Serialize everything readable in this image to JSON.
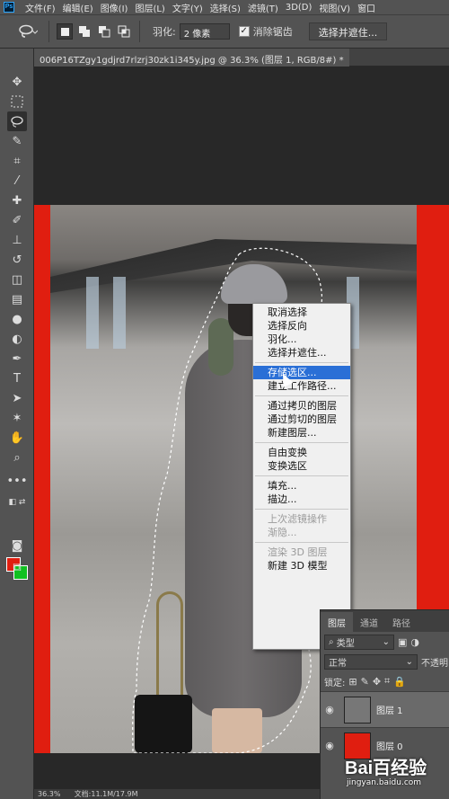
{
  "menubar": {
    "logo": "Ps",
    "items": [
      "文件(F)",
      "编辑(E)",
      "图像(I)",
      "图层(L)",
      "文字(Y)",
      "选择(S)",
      "滤镜(T)",
      "3D(D)",
      "视图(V)",
      "窗口"
    ]
  },
  "options": {
    "feather_label": "羽化:",
    "feather_value": "2 像素",
    "antialias_label": "消除锯齿",
    "select_mask_button": "选择并遮住..."
  },
  "document_tab": "006P16TZgy1gdjrd7rlzrj30zk1i345y.jpg @ 36.3% (图层 1, RGB/8#) *",
  "context_menu": {
    "items": [
      {
        "label": "取消选择",
        "state": "normal"
      },
      {
        "label": "选择反向",
        "state": "normal"
      },
      {
        "label": "羽化...",
        "state": "normal"
      },
      {
        "label": "选择并遮住...",
        "state": "normal"
      },
      {
        "label": "存储选区...",
        "state": "highlighted"
      },
      {
        "label": "建立工作路径...",
        "state": "normal"
      },
      {
        "label": "通过拷贝的图层",
        "state": "normal"
      },
      {
        "label": "通过剪切的图层",
        "state": "normal"
      },
      {
        "label": "新建图层...",
        "state": "normal"
      },
      {
        "label": "自由变换",
        "state": "normal"
      },
      {
        "label": "变换选区",
        "state": "normal"
      },
      {
        "label": "填充...",
        "state": "normal"
      },
      {
        "label": "描边...",
        "state": "normal"
      },
      {
        "label": "上次滤镜操作",
        "state": "disabled"
      },
      {
        "label": "渐隐...",
        "state": "disabled"
      },
      {
        "label": "渲染 3D 图层",
        "state": "disabled"
      },
      {
        "label": "新建 3D 模型",
        "state": "normal"
      }
    ]
  },
  "layers_panel": {
    "tabs": [
      "图层",
      "通道",
      "路径"
    ],
    "filter_label": "类型",
    "blend_mode": "正常",
    "opacity_label": "不透明",
    "lock_label": "锁定:",
    "layers": [
      {
        "name": "图层 1",
        "selected": true,
        "thumb_color": "#777777"
      },
      {
        "name": "图层 0",
        "selected": false,
        "thumb_color": "#e01e10"
      }
    ]
  },
  "status": {
    "zoom": "36.3%",
    "doc_info": "文档:11.1M/17.9M"
  },
  "colors": {
    "foreground": "#e01e10",
    "background": "#10c020",
    "canvas_red": "#e01e10"
  },
  "watermark": {
    "brand": "Bai百经验",
    "url": "jingyan.baidu.com"
  }
}
